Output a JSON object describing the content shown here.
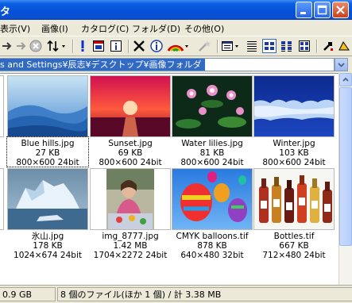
{
  "window": {
    "title_fragment": "タ"
  },
  "menu": {
    "items": [
      "表示(V)",
      "画像(I)",
      "カタログ(C)",
      "フォルダ(D)",
      "その他(O)"
    ]
  },
  "toolbar": {
    "icons": [
      "forward-arrow-icon",
      "stop-icon",
      "sort-icon",
      "exclamation-icon",
      "frame-icon",
      "info-icon",
      "delete-icon",
      "properties-icon",
      "color-icon",
      "wand-icon",
      "view-menu-icon",
      "list-view-icon",
      "large-icons-view-icon",
      "detail-view-icon",
      "thumbnail-view-icon",
      "tool-icon",
      "help-icon"
    ]
  },
  "address": {
    "path": "s and Settings¥辰志¥デスクトップ¥画像フォルダ"
  },
  "files": [
    {
      "name": "Blue hills.jpg",
      "size": "27 KB",
      "dims": "800×600  24bit"
    },
    {
      "name": "Sunset.jpg",
      "size": "69 KB",
      "dims": "800×600  24bit"
    },
    {
      "name": "Water lilies.jpg",
      "size": "81 KB",
      "dims": "800×600  24bit"
    },
    {
      "name": "Winter.jpg",
      "size": "103 KB",
      "dims": "800×600  24bit"
    },
    {
      "name": "氷山.jpg",
      "size": "178 KB",
      "dims": "1024×674  24bit"
    },
    {
      "name": "img_8777.jpg",
      "size": "1.42 MB",
      "dims": "1704×2272  24bit"
    },
    {
      "name": "CMYK balloons.tif",
      "size": "878 KB",
      "dims": "640×480  32bit"
    },
    {
      "name": "Bottles.tif",
      "size": "667 KB",
      "dims": "712×480  24bit"
    }
  ],
  "status": {
    "disk": "0.9 GB",
    "summary": "8 個のファイル(ほか 1 個) / 計 3.38 MB"
  },
  "colors": {
    "titlebar": "#0550d8",
    "selection": "#316ac5",
    "chrome": "#ece9d8"
  }
}
